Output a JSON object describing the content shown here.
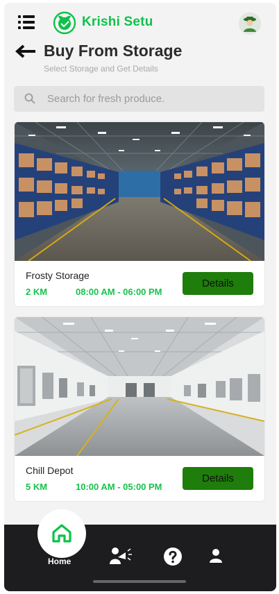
{
  "app": {
    "brand": "Krishi Setu",
    "accent_color": "#0ec24a",
    "button_color": "#1e7d0b",
    "nav_color": "#1d1d1f"
  },
  "header": {
    "menu_icon": "menu-icon",
    "logo_icon": "leaf-logo-icon",
    "avatar_icon": "farmer-avatar-icon"
  },
  "page": {
    "title": "Buy From Storage",
    "subtitle": "Select Storage and Get Details",
    "back_icon": "arrow-left-icon"
  },
  "search": {
    "placeholder": "Search for fresh produce.",
    "value": "",
    "icon": "search-icon"
  },
  "storages": [
    {
      "name": "Frosty Storage",
      "distance": "2 KM",
      "hours": "08:00 AM - 06:00 PM",
      "button_label": "Details",
      "image": "warehouse-with-shelves"
    },
    {
      "name": "Chill Depot",
      "distance": "5 KM",
      "hours": "10:00 AM - 05:00 PM",
      "button_label": "Details",
      "image": "cold-storage-hall"
    }
  ],
  "nav": {
    "items": [
      {
        "label": "Home",
        "icon": "home-icon",
        "active": true
      },
      {
        "label": "",
        "icon": "announce-icon",
        "active": false
      },
      {
        "label": "",
        "icon": "help-icon",
        "active": false
      },
      {
        "label": "",
        "icon": "profile-icon",
        "active": false
      }
    ]
  }
}
